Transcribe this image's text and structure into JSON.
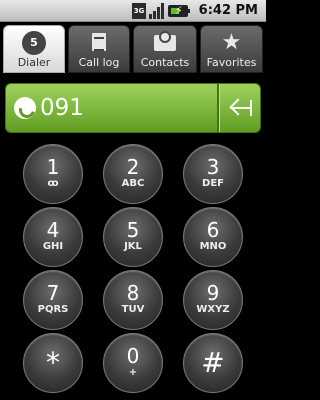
{
  "status_bar": {
    "network_label": "3G",
    "time": "6:42 PM"
  },
  "tabs": [
    {
      "label": "Dialer",
      "icon": "dialer-icon",
      "badge": "5",
      "active": true
    },
    {
      "label": "Call log",
      "icon": "call-log-icon",
      "active": false
    },
    {
      "label": "Contacts",
      "icon": "contacts-icon",
      "active": false
    },
    {
      "label": "Favorites",
      "icon": "star-icon",
      "active": false
    }
  ],
  "dial_field": {
    "number": "091"
  },
  "keys": [
    {
      "digit": "1",
      "sub": "ꝏ",
      "name": "key-1"
    },
    {
      "digit": "2",
      "sub": "ABC",
      "name": "key-2"
    },
    {
      "digit": "3",
      "sub": "DEF",
      "name": "key-3"
    },
    {
      "digit": "4",
      "sub": "GHI",
      "name": "key-4"
    },
    {
      "digit": "5",
      "sub": "JKL",
      "name": "key-5"
    },
    {
      "digit": "6",
      "sub": "MNO",
      "name": "key-6"
    },
    {
      "digit": "7",
      "sub": "PQRS",
      "name": "key-7"
    },
    {
      "digit": "8",
      "sub": "TUV",
      "name": "key-8"
    },
    {
      "digit": "9",
      "sub": "WXYZ",
      "name": "key-9"
    },
    {
      "digit": "*",
      "sub": "",
      "name": "key-star"
    },
    {
      "digit": "0",
      "sub": "+",
      "name": "key-0"
    },
    {
      "digit": "#",
      "sub": "",
      "name": "key-hash"
    }
  ],
  "colors": {
    "accent_green": "#7cb940",
    "battery_green": "#5ec12b"
  }
}
